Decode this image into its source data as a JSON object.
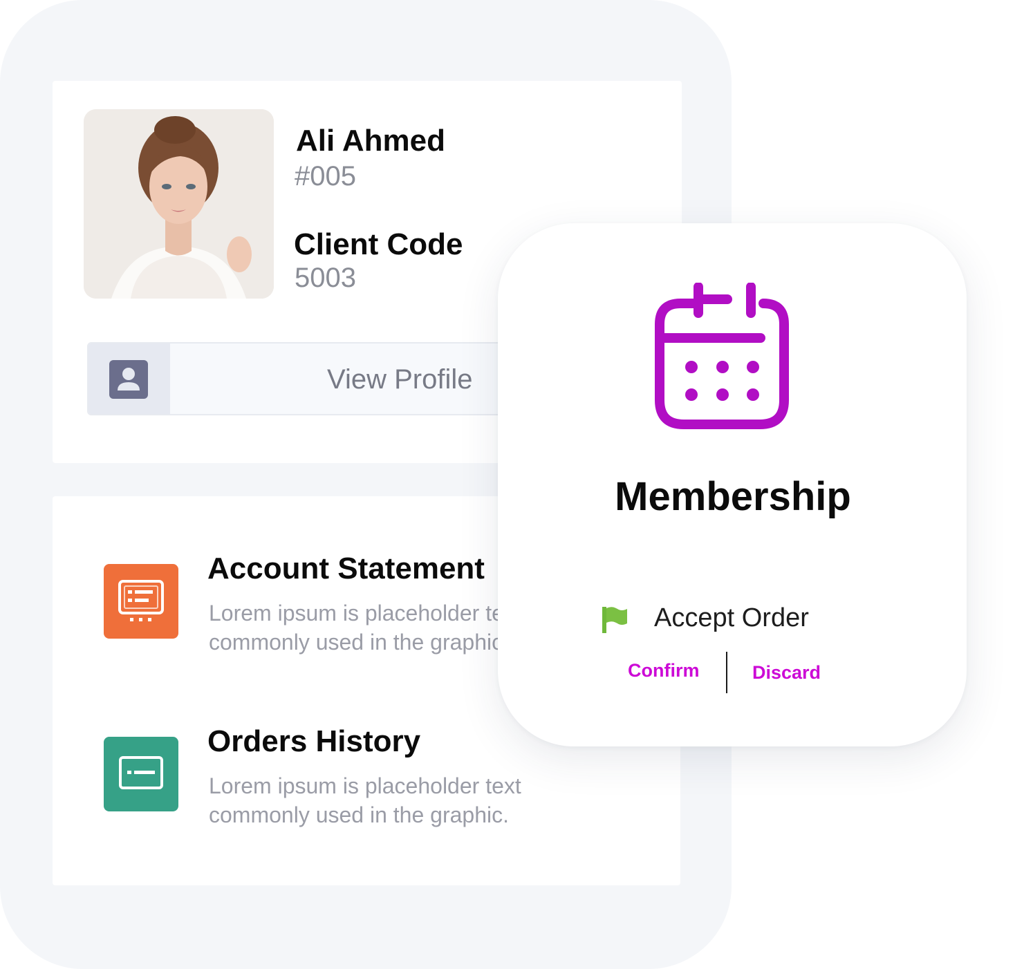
{
  "profile": {
    "name": "Ali Ahmed",
    "member_id": "#005",
    "client_code_label": "Client Code",
    "client_code_value": "5003",
    "view_profile_label": "View Profile"
  },
  "menu": {
    "items": [
      {
        "title": "Account Statement",
        "description": "Lorem ipsum is placeholder text commonly used in the graphic.",
        "icon": "statement-icon",
        "color": "#ef6f3a"
      },
      {
        "title": "Orders History",
        "description": "Lorem ipsum is placeholder text commonly used in the graphic.",
        "icon": "card-icon",
        "color": "#36a187"
      }
    ]
  },
  "membership": {
    "title": "Membership",
    "icon": "calendar-icon",
    "accent_color": "#b10ec4",
    "accept_label": "Accept Order",
    "confirm_label": "Confirm",
    "discard_label": "Discard",
    "action_color": "#cc0ad6"
  }
}
